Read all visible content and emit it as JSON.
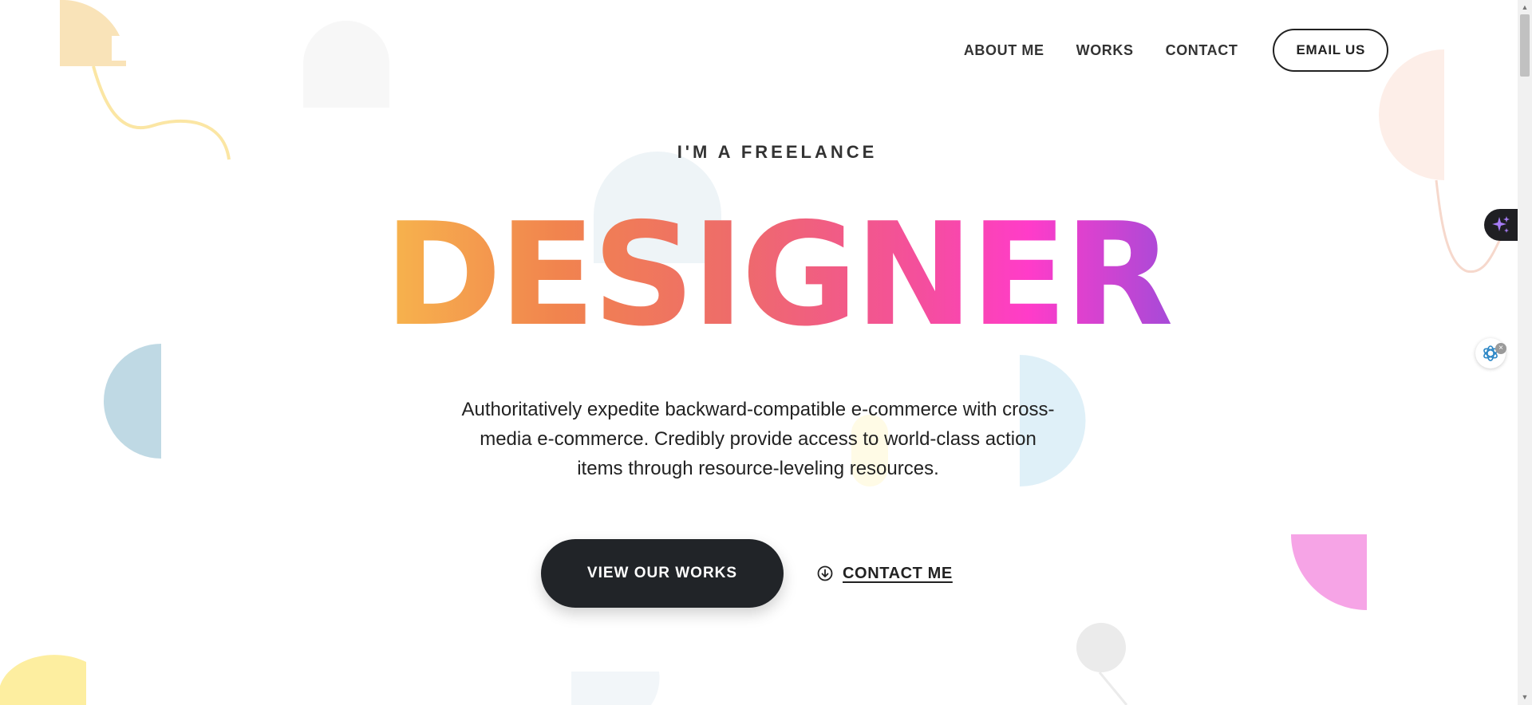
{
  "nav": {
    "items": [
      {
        "label": "ABOUT ME"
      },
      {
        "label": "WORKS"
      },
      {
        "label": "CONTACT"
      }
    ],
    "email_button": "EMAIL US"
  },
  "hero": {
    "eyebrow": "I'M A FREELANCE",
    "headline": "DESIGNER",
    "description": "Authoritatively expedite backward-compatible e-commerce with cross-media e-commerce. Credibly provide access to world-class action items through resource-leveling resources.",
    "primary_button": "VIEW OUR WORKS",
    "secondary_link": "CONTACT ME"
  },
  "colors": {
    "gradient": [
      "#f7b54d",
      "#f1844e",
      "#ee6b6b",
      "#f44f9c",
      "#ff3cc9",
      "#a74ad8"
    ],
    "dark_button": "#212428"
  },
  "icons": {
    "contact_link": "arrow-down-circle-icon",
    "ai_tab": "sparkle-icon",
    "chat_widget": "chatgpt-icon"
  }
}
